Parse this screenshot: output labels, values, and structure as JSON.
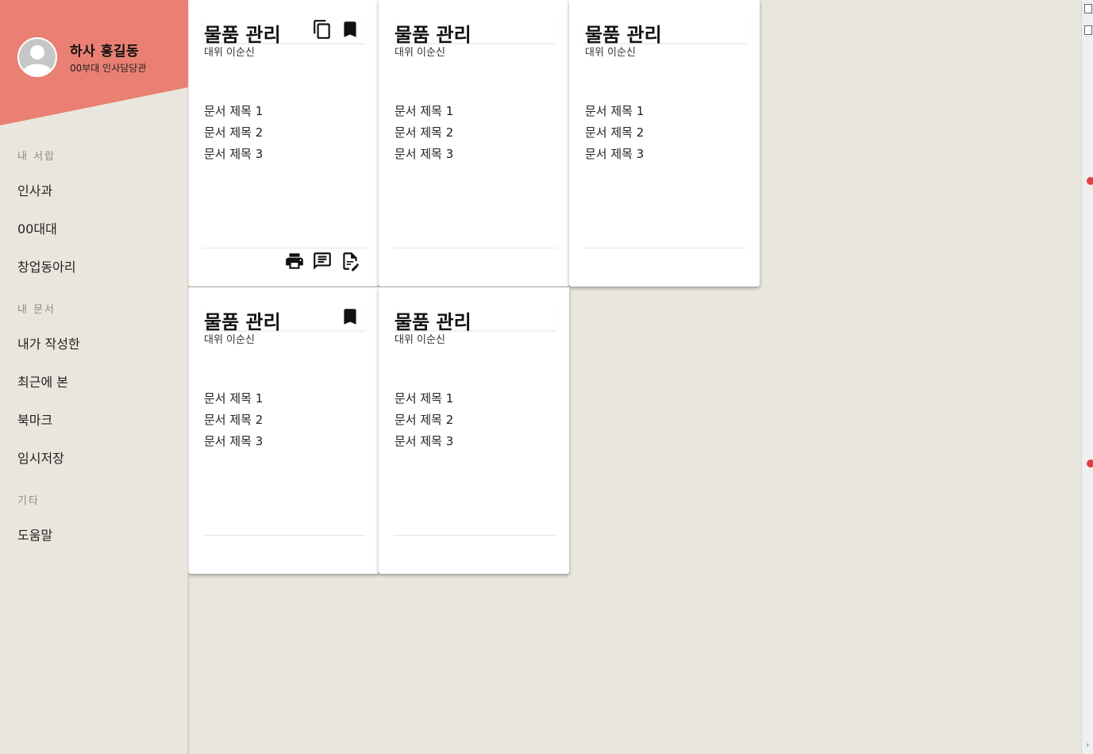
{
  "profile": {
    "name": "하사 홍길동",
    "role": "00부대 인사담당관",
    "banner_color": "#e98073"
  },
  "nav": {
    "section_library": "내 서랍",
    "library_items": [
      "인사과",
      "00대대",
      "창업동아리"
    ],
    "section_documents": "내 문서",
    "document_items": [
      "내가 작성한",
      "최근에 본",
      "북마크",
      "임시저장"
    ],
    "section_other": "기타",
    "other_items": [
      "도움말"
    ]
  },
  "cards": [
    {
      "title": "물품 관리",
      "author": "대위 이순신",
      "docs": [
        "문서 제목 1",
        "문서 제목 2",
        "문서 제목 3"
      ],
      "header_icons": [
        "copy-icon",
        "bookmark-icon"
      ],
      "footer_icons": [
        "print-icon",
        "comment-icon",
        "edit-document-icon"
      ]
    },
    {
      "title": "물품 관리",
      "author": "대위 이순신",
      "docs": [
        "문서 제목 1",
        "문서 제목 2",
        "문서 제목 3"
      ],
      "header_icons": [],
      "footer_icons": []
    },
    {
      "title": "물품 관리",
      "author": "대위 이순신",
      "docs": [
        "문서 제목 1",
        "문서 제목 2",
        "문서 제목 3"
      ],
      "header_icons": [],
      "footer_icons": []
    },
    {
      "title": "물품 관리",
      "author": "대위 이순신",
      "docs": [
        "문서 제목 1",
        "문서 제목 2",
        "문서 제목 3"
      ],
      "header_icons": [
        "bookmark-icon"
      ],
      "footer_icons": []
    },
    {
      "title": "물품 관리",
      "author": "대위 이순신",
      "docs": [
        "문서 제목 1",
        "문서 제목 2",
        "문서 제목 3"
      ],
      "header_icons": [],
      "footer_icons": []
    }
  ]
}
